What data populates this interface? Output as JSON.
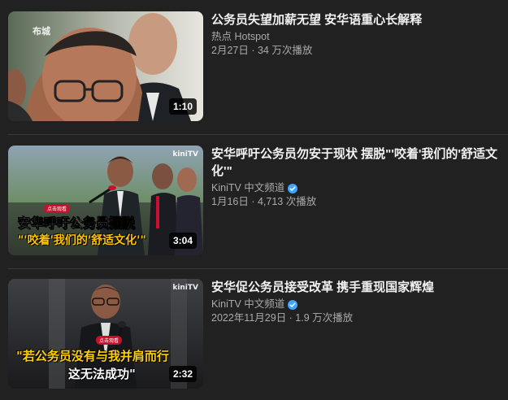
{
  "videos": [
    {
      "title": "公务员失望加薪无望 安华语重心长解释",
      "channel": "热点 Hotspot",
      "verified": false,
      "stats": "2月27日 · 34 万次播放",
      "duration": "1:10",
      "thumb_logo": "布城"
    },
    {
      "title": "安华呼吁公务员勿安于现状 摆脱\"'咬着'我们的'舒适文化'\"",
      "channel": "KiniTV 中文频道",
      "verified": true,
      "stats": "1月16日 · 4,713 次播放",
      "duration": "3:04",
      "thumb_logo": "kiniTV",
      "thumb_badge": "点击观看",
      "thumb_line1a": "安华呼吁公务员",
      "thumb_line1b": "摆脱",
      "thumb_line2a": "\"'咬着'我们的'",
      "thumb_line2b": "舒适文化",
      "thumb_line2c": "'\""
    },
    {
      "title": "安华促公务员接受改革 携手重现国家辉煌",
      "channel": "KiniTV 中文频道",
      "verified": true,
      "stats": "2022年11月29日 · 1.9 万次播放",
      "duration": "2:32",
      "thumb_logo": "kiniTV",
      "thumb_badge": "点击观看",
      "thumb_line1": "\"若公务员没有与我并肩而行",
      "thumb_line2": "这无法成功\""
    }
  ]
}
